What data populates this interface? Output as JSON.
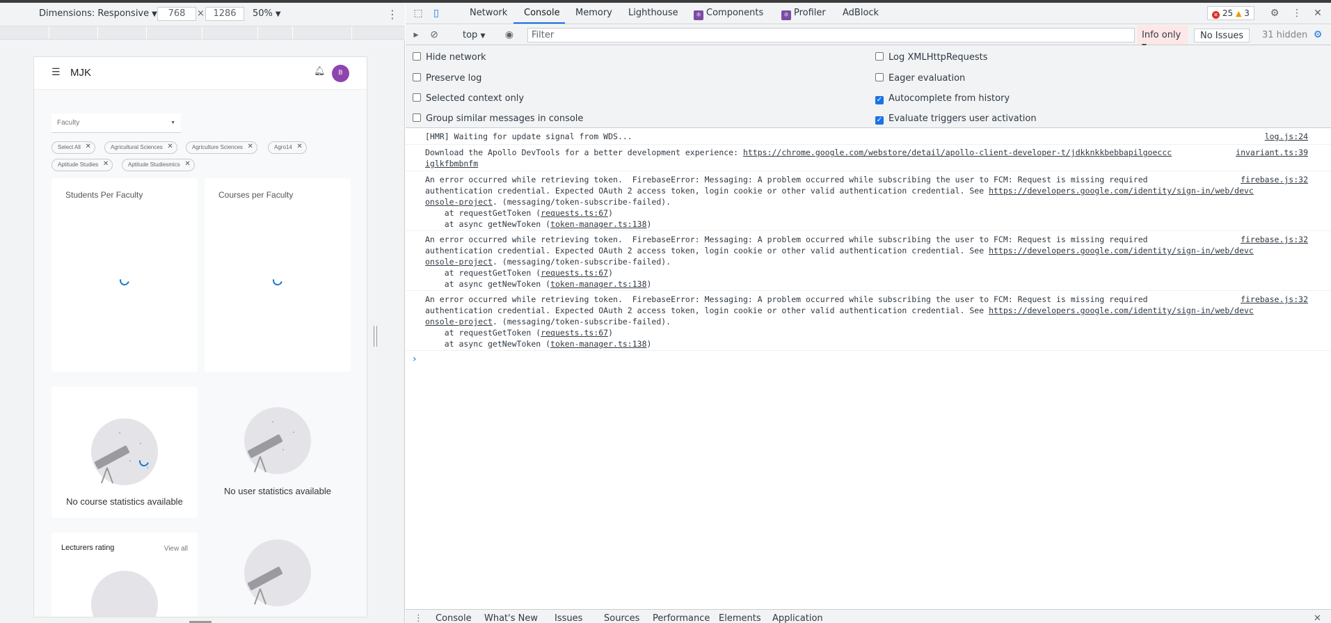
{
  "device_toolbar": {
    "dimensions_label": "Dimensions: Responsive",
    "width": "768",
    "height": "1286",
    "times": "×",
    "zoom": "50%"
  },
  "app": {
    "brand": "MJK",
    "avatar_initial": "B",
    "faculty_placeholder": "Faculty",
    "chips": [
      "Select All",
      "Agricultural Sciences",
      "Agriculture Sciences",
      "Agro14",
      "Aptitude Studies",
      "Aptitude Studiesmics"
    ],
    "card_students": "Students Per Faculty",
    "card_courses": "Courses per Faculty",
    "no_course": "No course statistics available",
    "no_user": "No user statistics available",
    "lecturers_rating": "Lecturers rating",
    "view_all": "View all"
  },
  "devtools": {
    "tabs": [
      "Network",
      "Console",
      "Memory",
      "Lighthouse",
      "Components",
      "Profiler",
      "AdBlock"
    ],
    "active_tab": "Console",
    "error_count": "25",
    "warning_count": "3",
    "context": "top",
    "filter_placeholder": "Filter",
    "levels": "Info only",
    "no_issues": "No Issues",
    "hidden_count": "31 hidden",
    "settings": {
      "hide_network": "Hide network",
      "preserve_log": "Preserve log",
      "selected_context": "Selected context only",
      "group_similar": "Group similar messages in console",
      "log_xhr": "Log XMLHttpRequests",
      "eager_eval": "Eager evaluation",
      "autocomplete": "Autocomplete from history",
      "evaluate_triggers": "Evaluate triggers user activation"
    },
    "messages": [
      {
        "line1": "[HMR] Waiting for update signal from WDS...",
        "src": "log.js:24"
      },
      {
        "line1a": "Download the Apollo DevTools for a better development experience: ",
        "link1": "https://chrome.google.com/webstore/detail/apollo-client-developer-t/jdkknkkbebbapilgoeccc",
        "link2": "iglkfbmbnfm",
        "src": "invariant.ts:39"
      },
      {
        "line1": "An error occurred while retrieving token.  FirebaseError: Messaging: A problem occurred while subscribing the user to FCM: Request is missing required",
        "line2a": "authentication credential. Expected OAuth 2 access token, login cookie or other valid authentication credential. See ",
        "link": "https://developers.google.com/identity/sign-in/web/devc",
        "link_b": "onsole-project",
        "line3b": ". (messaging/token-subscribe-failed).",
        "stack1a": "    at requestGetToken (",
        "stack1l": "requests.ts:67",
        "stack2a": "    at async getNewToken (",
        "stack2l": "token-manager.ts:138",
        "close": ")",
        "src": "firebase.js:32"
      }
    ],
    "drawer_tabs": [
      "Console",
      "What's New",
      "Issues",
      "Sources",
      "Performance",
      "Elements",
      "Application"
    ]
  }
}
